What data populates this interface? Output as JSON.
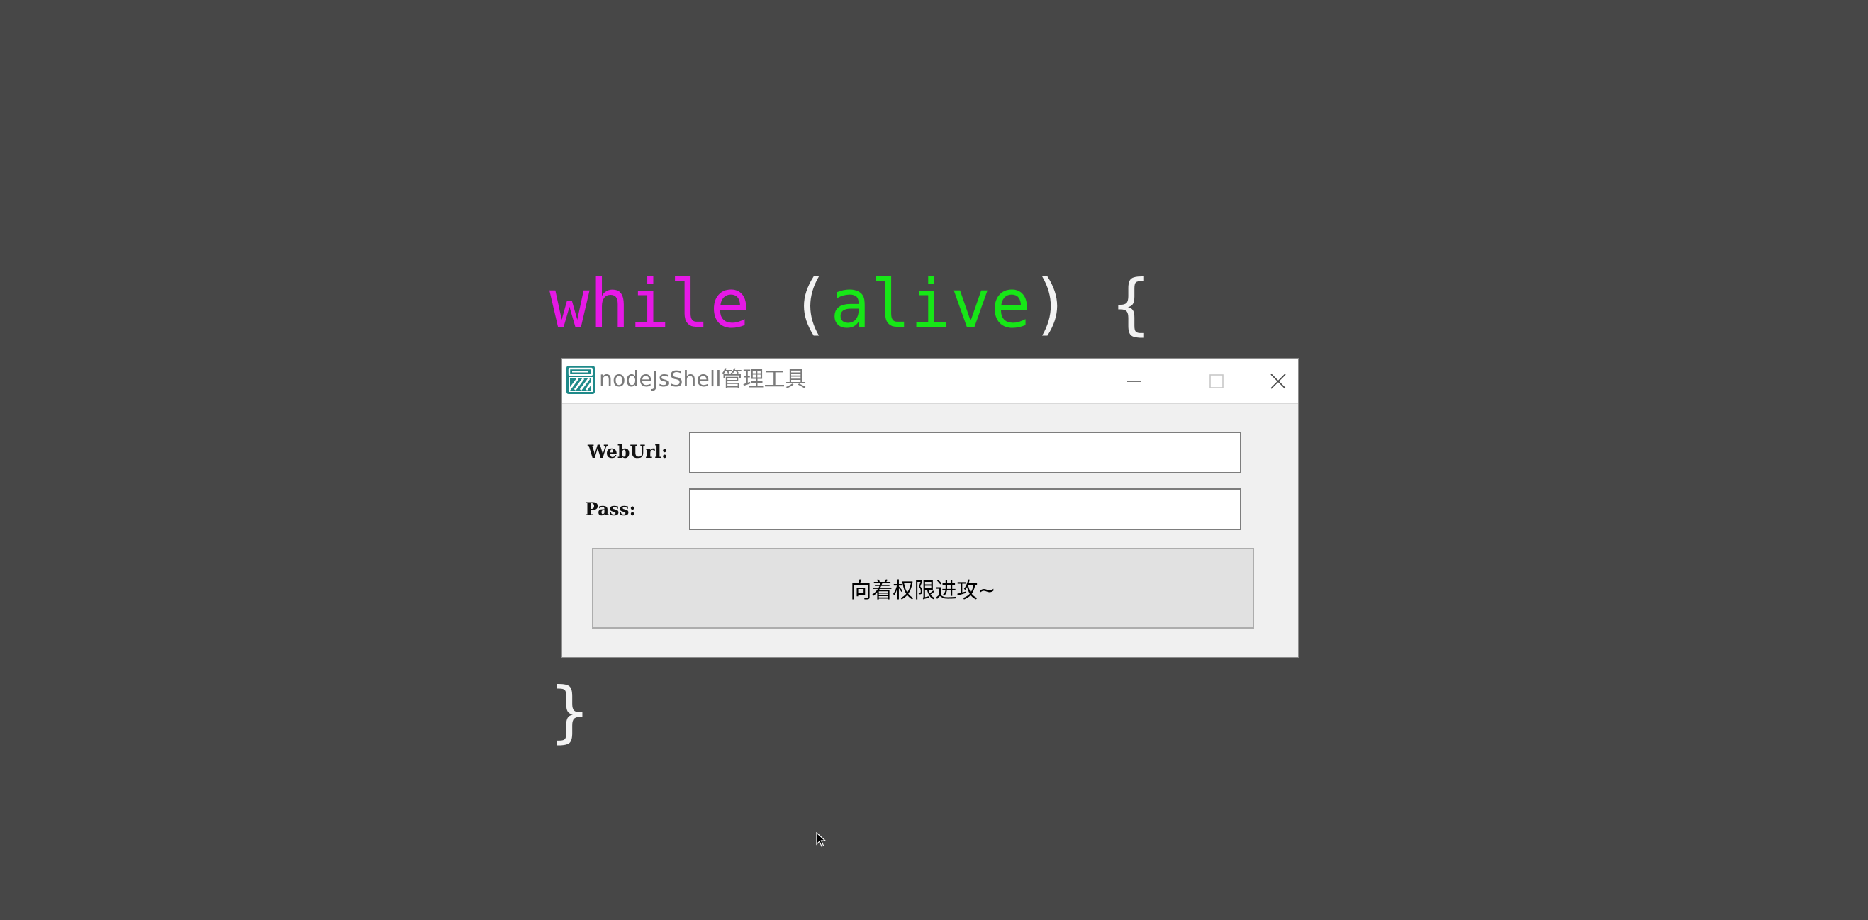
{
  "code": {
    "line1": {
      "keyword": "while",
      "open_paren": " (",
      "variable": "alive",
      "close": ") {"
    },
    "closing_brace": "}"
  },
  "window": {
    "title": "nodeJsShell管理工具",
    "app_icon": "terminal-app-icon",
    "minimize_icon": "minimize-icon",
    "maximize_icon": "maximize-icon",
    "close_icon": "close-icon"
  },
  "form": {
    "weburl_label": "WebUrl:",
    "weburl_value": "",
    "pass_label": "Pass:",
    "pass_value": "",
    "submit_label": "向着权限进攻~"
  },
  "colors": {
    "desktop": "#474747",
    "keyword": "#e619e6",
    "variable": "#17e617",
    "punctuation": "#f2f2f2",
    "window_bg": "#f0f0f0",
    "button_bg": "#e1e1e1"
  }
}
